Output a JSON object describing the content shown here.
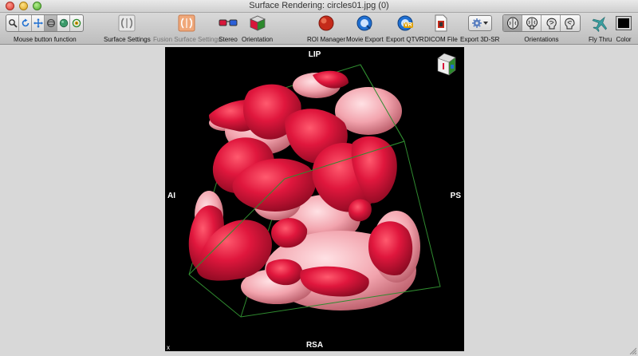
{
  "window": {
    "title": "Surface Rendering: circles01.jpg (0)"
  },
  "toolbar": {
    "mouse_group_label": "Mouse button function",
    "mouse_tools": [
      {
        "icon": "zoom-icon"
      },
      {
        "icon": "rotate-icon"
      },
      {
        "icon": "pan-icon"
      },
      {
        "icon": "camera-rotate-icon"
      },
      {
        "icon": "sphere-icon"
      },
      {
        "icon": "target-icon"
      }
    ],
    "surface_settings_label": "Surface Settings",
    "fusion_surface_settings_label": "Fusion Surface Settings",
    "stereo_label": "Stereo",
    "orientation_label": "Orientation",
    "roi_manager_label": "ROI Manager",
    "movie_export_label": "Movie Export",
    "export_qtvr_label": "Export QTVR",
    "export_qtvr_badge": "VR",
    "dicom_file_label": "DICOM File",
    "export_3dsr_label": "Export 3D-SR",
    "orientations_label": "Orientations",
    "fly_thru_label": "Fly Thru",
    "color_label": "Color",
    "colors": {
      "accent": "#1f6fd1",
      "color_well": "#000000"
    }
  },
  "viewer": {
    "label_top": "LIP",
    "label_bottom": "RSA",
    "label_left": "AI",
    "label_right": "PS",
    "corner_label": "x",
    "colors": {
      "surface": "#d8163a",
      "surface_light": "#f2a3ad",
      "box_edges": "#2f8a2f",
      "background": "#000000"
    }
  }
}
